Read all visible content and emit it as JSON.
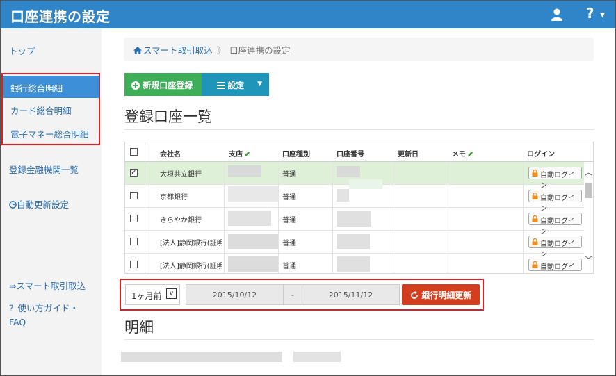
{
  "header": {
    "title": "口座連携の設定",
    "help_label": "?"
  },
  "sidebar": {
    "top": "トップ",
    "bank": "銀行総合明細",
    "card": "カード総合明細",
    "emoney": "電子マネー総合明細",
    "institutions": "登録金融機関一覧",
    "auto_update": "自動更新設定",
    "smart_import": "⇒スマート取引取込",
    "guide_line1": "？使い方ガイド・",
    "guide_line2": "FAQ"
  },
  "breadcrumb": {
    "parent": "スマート取引取込",
    "separator": "》",
    "current": "口座連携の設定"
  },
  "toolbar": {
    "new_account": "新規口座登録",
    "settings": "設定"
  },
  "accounts_section": {
    "title": "登録口座一覧"
  },
  "table": {
    "headers": {
      "company": "会社名",
      "branch": "支店",
      "type": "口座種別",
      "number": "口座番号",
      "updated": "更新日",
      "memo": "メモ",
      "login": "ログイン"
    },
    "rows": [
      {
        "checked": "✓",
        "company": "大垣共立銀行",
        "type": "普通",
        "login": "自動ログイン"
      },
      {
        "checked": "",
        "company": "京都銀行",
        "type": "普通",
        "login": "自動ログイン"
      },
      {
        "checked": "",
        "company": "きらやか銀行",
        "type": "普通",
        "login": "自動ログイン"
      },
      {
        "checked": "",
        "company": "[法人]静岡銀行(証明",
        "type": "普通",
        "login": "自動ログイン"
      },
      {
        "checked": "",
        "company": "[法人]静岡銀行(証明",
        "type": "普通",
        "login": "自動ログイン"
      }
    ]
  },
  "filter": {
    "period": "1ヶ月前",
    "date_from": "2015/10/12",
    "separator": "-",
    "date_to": "2015/11/12",
    "refresh": "銀行明細更新"
  },
  "detail_section": {
    "title": "明細"
  },
  "colors": {
    "header_bg": "#2f85c8",
    "active_bg": "#3d8fd8",
    "new_btn": "#3fae58",
    "settings_btn": "#1f95b9",
    "refresh_btn": "#d33f1e",
    "highlight_border": "#e02020",
    "selected_row": "#dff0d8"
  },
  "icons": {
    "user": "user-icon",
    "help": "help-icon",
    "home": "home-icon",
    "plus": "plus-circle-icon",
    "menu": "menu-icon",
    "clock": "clock-icon",
    "lock": "lock-icon",
    "refresh": "refresh-icon",
    "pencil": "pencil-icon"
  }
}
